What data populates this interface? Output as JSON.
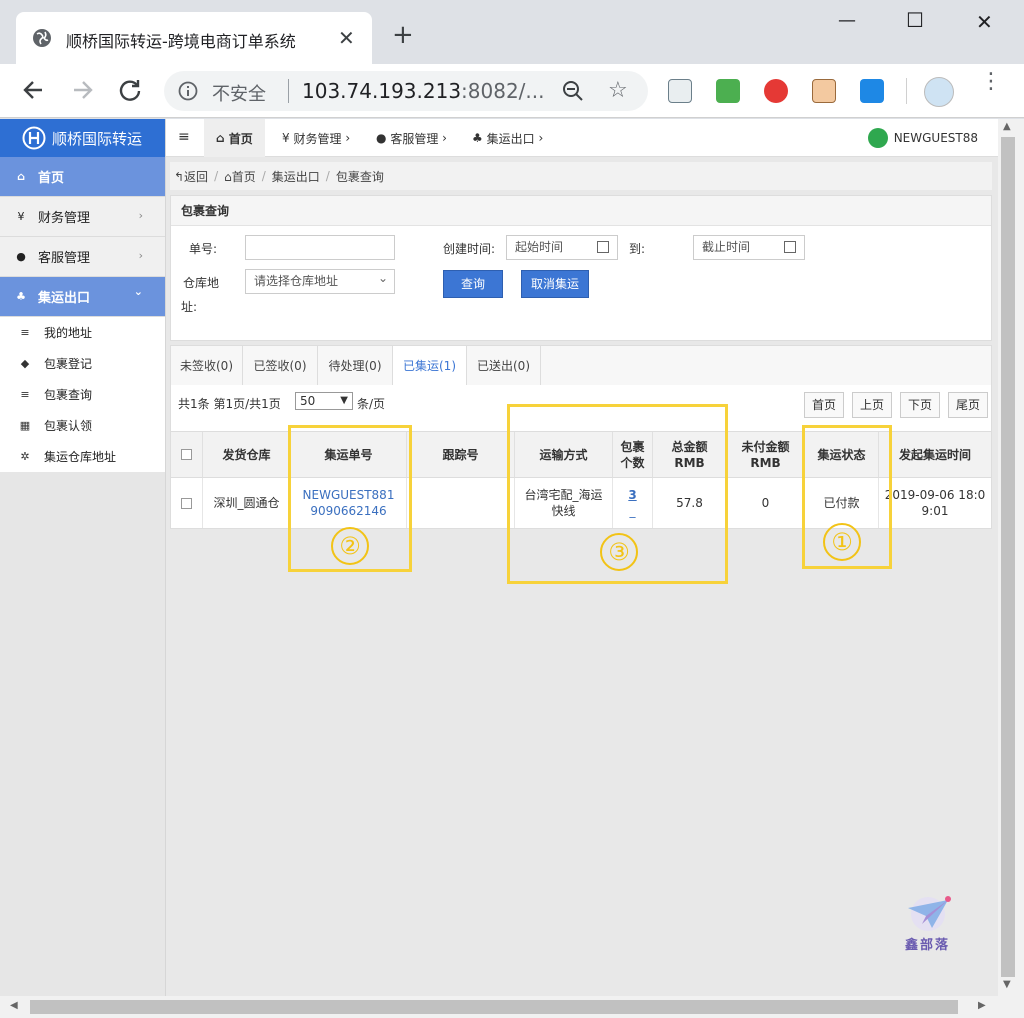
{
  "browser": {
    "tab_title": "顺桥国际转运-跨境电商订单系统",
    "close_glyph": "✕",
    "new_tab_glyph": "+",
    "insecure_label": "不安全",
    "url_host": "103.74.193.213",
    "url_rest": ":8082/...",
    "minimize_glyph": "—",
    "maximize_glyph": "☐",
    "close_window_glyph": "✕",
    "star_glyph": "☆",
    "menu_glyph": "⋮"
  },
  "sidebar": {
    "brand": "顺桥国际转运",
    "items": [
      {
        "label": "首页",
        "icon": "home-icon",
        "glyph": "⌂"
      },
      {
        "label": "财务管理",
        "icon": "yen-icon",
        "glyph": "¥"
      },
      {
        "label": "客服管理",
        "icon": "user-icon",
        "glyph": "●"
      },
      {
        "label": "集运出口",
        "icon": "cubes-icon",
        "glyph": "♣"
      }
    ],
    "chevron_right": "›",
    "chevron_down": "⌄",
    "subitems": [
      {
        "label": "我的地址",
        "glyph": "≡"
      },
      {
        "label": "包裹登记",
        "glyph": "◆"
      },
      {
        "label": "包裹查询",
        "glyph": "≡"
      },
      {
        "label": "包裹认领",
        "glyph": "▦"
      },
      {
        "label": "集运仓库地址",
        "glyph": "✲"
      }
    ]
  },
  "topnav": {
    "hamburger": "≡",
    "items": [
      {
        "label": "首页",
        "glyph": "⌂"
      },
      {
        "label": "财务管理",
        "glyph": "¥"
      },
      {
        "label": "客服管理",
        "glyph": "●"
      },
      {
        "label": "集运出口",
        "glyph": "♣"
      }
    ],
    "caret": "›",
    "username": "NEWGUEST88"
  },
  "breadcrumb": {
    "back": "↰返回",
    "items": [
      "⌂首页",
      "集运出口",
      "包裹查询"
    ],
    "sep": "/"
  },
  "search_panel": {
    "title": "包裹查询",
    "order_no_label": "单号:",
    "order_no_value": "",
    "created_label": "创建时间:",
    "start_placeholder": "起始时间",
    "to_label": "到:",
    "end_placeholder": "截止时间",
    "warehouse_label_1": "仓库地",
    "warehouse_label_2": "址:",
    "warehouse_select": "请选择仓库地址",
    "query_button": "查询",
    "cancel_button": "取消集运",
    "select_caret": "⌄"
  },
  "status_tabs": [
    "未签收(0)",
    "已签收(0)",
    "待处理(0)",
    "已集运(1)",
    "已送出(0)"
  ],
  "pager": {
    "summary": "共1条  第1页/共1页",
    "page_size": "50",
    "page_size_caret": "▼",
    "per_page": "条/页",
    "first": "首页",
    "prev": "上页",
    "next": "下页",
    "last": "尾页"
  },
  "table": {
    "headers": [
      "发货仓库",
      "集运单号",
      "跟踪号",
      "运输方式",
      "包裹个数",
      "总金额RMB",
      "未付金额RMB",
      "集运状态",
      "发起集运时间"
    ],
    "headers_split": {
      "pkg_1": "包裹",
      "pkg_2": "个数",
      "total_1": "总金额",
      "total_2": "RMB",
      "unpaid_1": "未付金额",
      "unpaid_2": "RMB"
    },
    "row": {
      "warehouse": "深圳_圆通仓",
      "order_no_1": "NEWGUEST881",
      "order_no_2": "9090662146",
      "tracking": "",
      "shipping_1": "台湾宅配_海运",
      "shipping_2": "快线",
      "packages": "3",
      "packages_under": "_",
      "total": "57.8",
      "unpaid": "0",
      "status": "已付款",
      "time_1": "2019-09-06 18:0",
      "time_2": "9:01"
    }
  },
  "annotations": [
    "①",
    "②",
    "③"
  ],
  "watermark": "鑫部落",
  "colors": {
    "brand_blue": "#2e6fd3",
    "active_menu": "#6b93dd",
    "button_blue": "#3c76d4",
    "annotation_yellow": "#f7d23a"
  }
}
